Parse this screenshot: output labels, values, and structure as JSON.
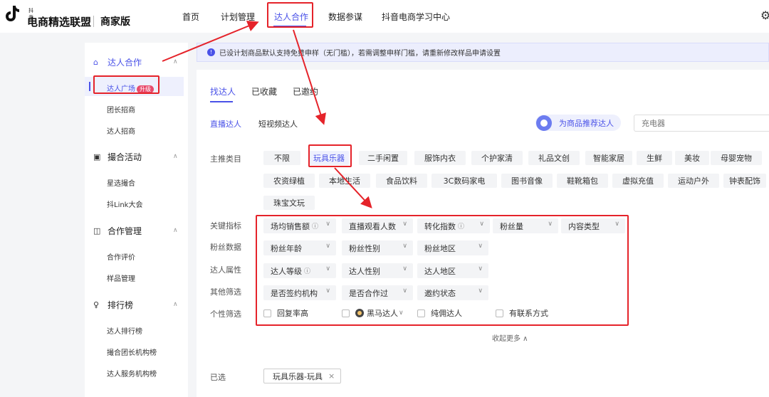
{
  "header": {
    "logo_small": "抖音",
    "logo_text": "电商精选联盟",
    "edition": "商家版",
    "nav": [
      "首页",
      "计划管理",
      "达人合作",
      "数据参谋",
      "抖音电商学习中心"
    ],
    "settings_icon": "gear-icon"
  },
  "sidebar": {
    "groups": [
      {
        "label": "达人合作",
        "icon": "home-icon",
        "items": [
          "达人广场",
          "团长招商",
          "达人招商"
        ],
        "badge": "升级"
      },
      {
        "label": "撮合活动",
        "icon": "activity-icon",
        "items": [
          "星选撮合",
          "抖Link大会"
        ]
      },
      {
        "label": "合作管理",
        "icon": "manage-icon",
        "items": [
          "合作评价",
          "样品管理"
        ]
      },
      {
        "label": "排行榜",
        "icon": "trophy-icon",
        "items": [
          "达人排行榜",
          "撮合团长机构榜",
          "达人服务机构榜"
        ]
      }
    ]
  },
  "notice": {
    "text": "已设计划商品默认支持免费申样（无门槛），若需调整申样门槛，请重新修改样品申请设置"
  },
  "tabs": [
    "找达人",
    "已收藏",
    "已邀约"
  ],
  "subtabs": [
    "直播达人",
    "短视频达人"
  ],
  "recommend_label": "为商品推荐达人",
  "search_placeholder": "充电器",
  "category": {
    "label": "主推类目",
    "row1": [
      "不限",
      "玩具乐器",
      "二手闲置",
      "服饰内衣",
      "个护家清",
      "礼品文创",
      "智能家居",
      "生鲜",
      "美妆",
      "母婴宠物"
    ],
    "row2": [
      "农资绿植",
      "本地生活",
      "食品饮料",
      "3C数码家电",
      "图书音像",
      "鞋靴箱包",
      "虚拟充值",
      "运动户外",
      "钟表配饰"
    ],
    "row3": [
      "珠宝文玩"
    ]
  },
  "filters": {
    "key_metrics_label": "关键指标",
    "key_metrics": [
      "场均销售额",
      "直播观看人数",
      "转化指数",
      "粉丝量",
      "内容类型"
    ],
    "fans_label": "粉丝数据",
    "fans": [
      "粉丝年龄",
      "粉丝性别",
      "粉丝地区"
    ],
    "attr_label": "达人属性",
    "attr": [
      "达人等级",
      "达人性别",
      "达人地区"
    ],
    "other_label": "其他筛选",
    "other": [
      "是否签约机构",
      "是否合作过",
      "邀约状态"
    ],
    "personal_label": "个性筛选",
    "personal": [
      "回复率高",
      "黑马达人",
      "纯佣达人",
      "有联系方式"
    ]
  },
  "collapse_label": "收起更多 ∧",
  "selected": {
    "label": "已选",
    "chip": "玩具乐器-玩具"
  },
  "colors": {
    "accent": "#4a52e8",
    "annotation": "#e5232a"
  }
}
